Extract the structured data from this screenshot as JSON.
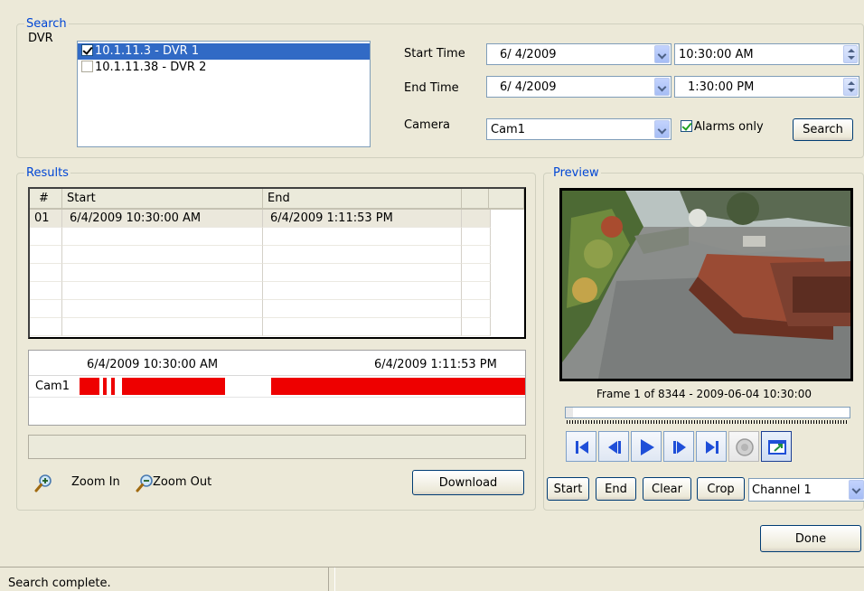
{
  "search": {
    "legend": "Search",
    "dvr_label": "DVR",
    "dvrs": [
      {
        "label": "10.1.11.3 - DVR 1",
        "checked": true,
        "selected": true
      },
      {
        "label": "10.1.11.38 - DVR 2",
        "checked": false,
        "selected": false
      }
    ],
    "start_time_label": "Start Time",
    "end_time_label": "End Time",
    "camera_label": "Camera",
    "start_date": "6/ 4/2009",
    "start_time": "10:30:00 AM",
    "end_date": "6/ 4/2009",
    "end_time": "1:30:00 PM",
    "camera_value": "Cam1",
    "alarms_only_label": "Alarms only",
    "alarms_only_checked": true,
    "search_button": "Search"
  },
  "results": {
    "legend": "Results",
    "columns": [
      "#",
      "Start",
      "End",
      "",
      ""
    ],
    "rows": [
      {
        "num": "01",
        "start": "6/4/2009 10:30:00 AM",
        "end": "6/4/2009 1:11:53 PM"
      }
    ],
    "timeline_start": "6/4/2009 10:30:00 AM",
    "timeline_end": "6/4/2009 1:11:53 PM",
    "timeline_track": "Cam1",
    "zoom_in_label": "Zoom In",
    "zoom_out_label": "Zoom Out",
    "download_button": "Download"
  },
  "preview": {
    "legend": "Preview",
    "frame_info": "Frame 1 of 8344 - 2009-06-04 10:30:00",
    "start_button": "Start",
    "end_button": "End",
    "clear_button": "Clear",
    "crop_button": "Crop",
    "channel_value": "Channel 1"
  },
  "footer": {
    "done_button": "Done",
    "status_text": "Search complete."
  },
  "colors": {
    "accent_blue": "#0046d5",
    "selection": "#316ac5",
    "timeline_bar": "#ee0000",
    "transport_icon": "#1f4fd8"
  },
  "icons": [
    "checkbox-icon",
    "dropdown-arrow-icon",
    "spinner-icon",
    "zoom-in-icon",
    "zoom-out-icon",
    "skip-start-icon",
    "step-back-icon",
    "play-icon",
    "step-forward-icon",
    "skip-end-icon",
    "audio-icon",
    "popout-icon"
  ]
}
